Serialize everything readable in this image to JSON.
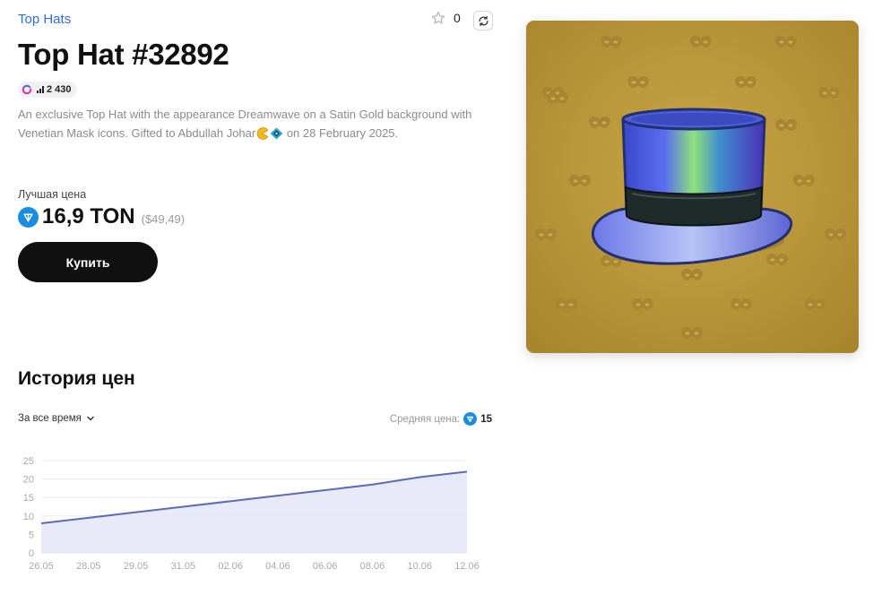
{
  "header": {
    "collection": "Top Hats",
    "favorites_count": "0"
  },
  "item": {
    "title": "Top Hat #32892",
    "rarity": "2 430",
    "description_main": "An exclusive Top Hat with the appearance Dreamwave on a Satin Gold background with Venetian Mask icons. Gifted to Abdullah Johar",
    "description_tail": " on 28 February 2025."
  },
  "price": {
    "label": "Лучшая цена",
    "value": "16,9 TON",
    "usd": "($49,49)"
  },
  "buy_button": "Купить",
  "history": {
    "title": "История цен",
    "period": "За все время",
    "avg_label": "Средняя цена:",
    "avg_value": "15"
  },
  "chart_data": {
    "type": "area",
    "x": [
      "26.05",
      "28.05",
      "29.05",
      "31.05",
      "02.06",
      "04.06",
      "06.06",
      "08.06",
      "10.06",
      "12.06"
    ],
    "series": [
      {
        "values": [
          8,
          9.5,
          11,
          12.5,
          14,
          15.5,
          17,
          18.5,
          20.5,
          22
        ]
      }
    ],
    "yticks": [
      0,
      5,
      10,
      15,
      20,
      25
    ],
    "ylim": [
      0,
      25
    ],
    "grid": true,
    "line_color": "#5b6bb8",
    "fill_color": "#e4e6f9"
  },
  "colors": {
    "accent_link": "#2f6fdc",
    "ton": "#1a8de0",
    "card_background": "#bc9a3a",
    "button": "#101010"
  },
  "icons": {
    "favorite": "star-icon",
    "refresh": "refresh-icon",
    "currency": "ton-icon",
    "dropdown": "chevron-down-icon"
  }
}
